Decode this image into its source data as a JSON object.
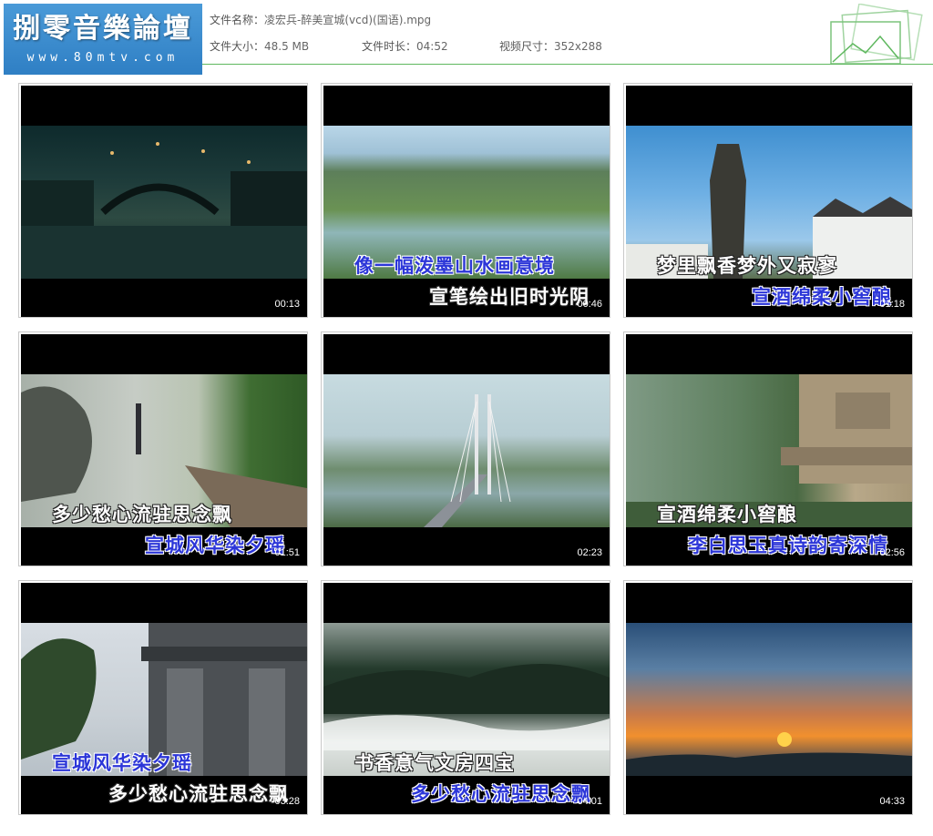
{
  "logo": {
    "title": "捌零音樂論壇",
    "url": "www.80mtv.com"
  },
  "meta": {
    "name_label": "文件名称：",
    "name_value": "凌宏兵-醉美宣城(vcd)(国语).mpg",
    "size_label": "文件大小：",
    "size_value": "48.5 MB",
    "duration_label": "文件时长：",
    "duration_value": "04:52",
    "dims_label": "视频尺寸：",
    "dims_value": "352x288"
  },
  "colors": {
    "accent_line": "#5fb85f",
    "logo_bg": "#3a8bcf",
    "subtitle_blue": "#2c36d8"
  },
  "thumbnails": [
    {
      "time": "00:13",
      "lines": []
    },
    {
      "time": "00:46",
      "lines": [
        {
          "text": "像一幅泼墨山水画意境",
          "color": "blue"
        },
        {
          "text": "宣笔绘出旧时光阴",
          "color": "white"
        }
      ]
    },
    {
      "time": "01:18",
      "lines": [
        {
          "text": "梦里飘香梦外又寂寥",
          "color": "white"
        },
        {
          "text": "宣酒绵柔小窖酿",
          "color": "blue"
        }
      ]
    },
    {
      "time": "01:51",
      "lines": [
        {
          "text": "多少愁心流驻思念飘",
          "color": "white"
        },
        {
          "text": "宣城风华染夕瑶",
          "color": "blue"
        }
      ]
    },
    {
      "time": "02:23",
      "lines": []
    },
    {
      "time": "02:56",
      "lines": [
        {
          "text": "宣酒绵柔小窖酿",
          "color": "white"
        },
        {
          "text": "李白思玉真诗韵寄深情",
          "color": "blue"
        }
      ]
    },
    {
      "time": "03:28",
      "lines": [
        {
          "text": "宣城风华染夕瑶",
          "color": "blue"
        },
        {
          "text": "多少愁心流驻思念飘",
          "color": "white"
        }
      ]
    },
    {
      "time": "04:01",
      "lines": [
        {
          "text": "书香意气文房四宝",
          "color": "white"
        },
        {
          "text": "多少愁心流驻思念飘",
          "color": "blue"
        }
      ]
    },
    {
      "time": "04:33",
      "lines": []
    }
  ]
}
